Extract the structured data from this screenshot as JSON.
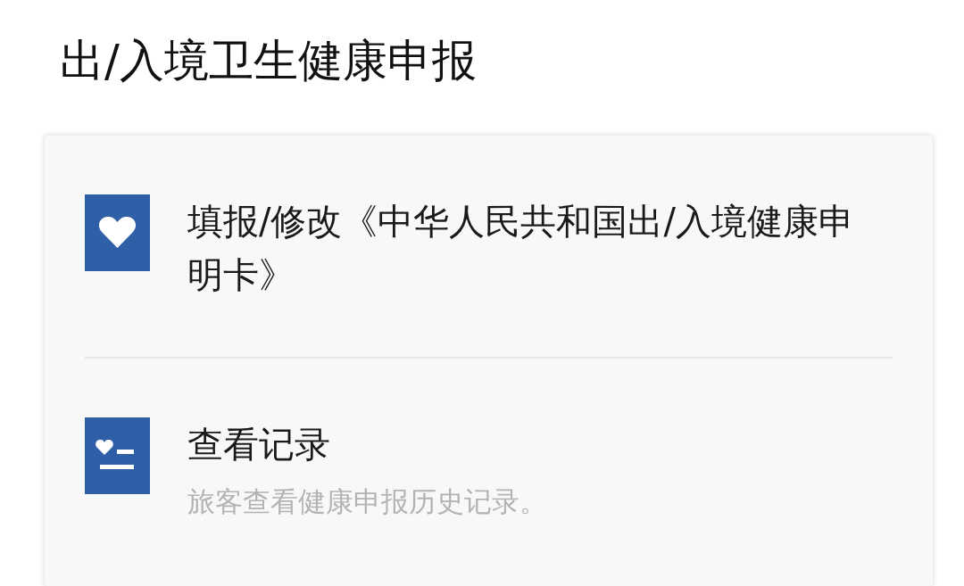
{
  "title": "出/入境卫生健康申报",
  "items": [
    {
      "kind": "heart",
      "label": "填报/修改《中华人民共和国出/入境健康申明卡》"
    },
    {
      "kind": "record",
      "label": "查看记录",
      "description": "旅客查看健康申报历史记录。"
    }
  ]
}
